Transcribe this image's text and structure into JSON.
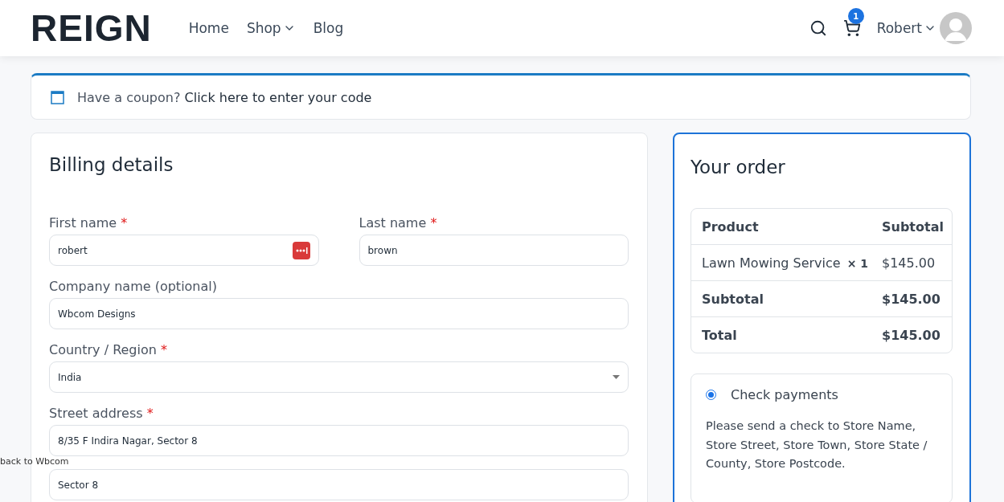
{
  "header": {
    "logo": "REIGN",
    "nav": [
      {
        "label": "Home",
        "dropdown": false
      },
      {
        "label": "Shop",
        "dropdown": true
      },
      {
        "label": "Blog",
        "dropdown": false
      }
    ],
    "cart_count": "1",
    "user": "Robert"
  },
  "coupon": {
    "prompt": "Have a coupon?",
    "link": "Click here to enter your code"
  },
  "billing": {
    "title": "Billing details",
    "fields": [
      {
        "label": "First name",
        "required_mark": "*",
        "kind": "text",
        "value": "robert",
        "half": true,
        "password_manager": true
      },
      {
        "label": "Last name",
        "required_mark": "*",
        "kind": "text",
        "value": "brown",
        "half": true,
        "password_manager": false
      },
      {
        "label": "Company name (optional)",
        "kind": "text",
        "value": "Wbcom Designs",
        "half": false,
        "password_manager": false
      },
      {
        "label": "Country / Region",
        "required_mark": "*",
        "kind": "select",
        "value": "India",
        "half": false,
        "password_manager": false
      },
      {
        "label": "Street address",
        "required_mark": "*",
        "kind": "text",
        "value": "8/35 F Indira Nagar, Sector 8",
        "half": false,
        "password_manager": false
      },
      {
        "kind": "text",
        "value": "Sector 8",
        "half": false,
        "password_manager": false
      }
    ]
  },
  "overlay_text": "back to Wbcom",
  "order": {
    "title": "Your order",
    "columns": [
      "Product",
      "Subtotal"
    ],
    "rows": [
      {
        "kind": "item",
        "name": "Lawn Mowing Service",
        "quantity": "× 1",
        "amount": "$145.00"
      },
      {
        "kind": "subtotal",
        "name": "Subtotal",
        "amount": "$145.00"
      },
      {
        "kind": "total",
        "name": "Total",
        "amount": "$145.00"
      }
    ],
    "payment_methods": [
      {
        "label": "Check payments",
        "selected": true,
        "description": "Please send a check to Store Name, Store Street, Store Town, Store State / County, Store Postcode."
      }
    ]
  }
}
